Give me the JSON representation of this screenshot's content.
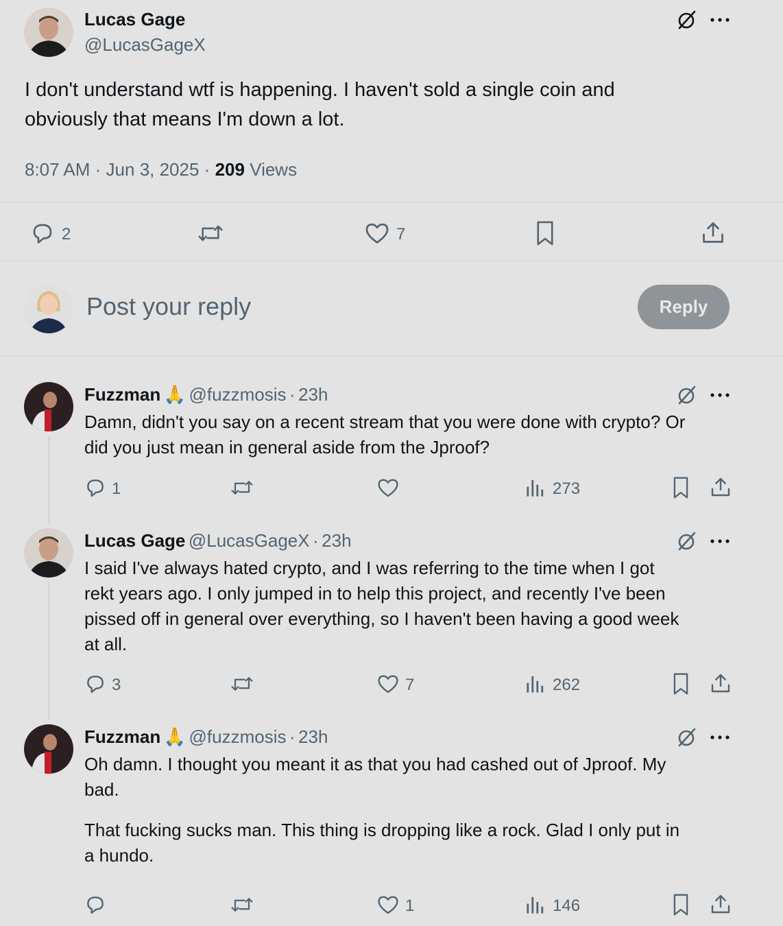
{
  "main_post": {
    "author_name": "Lucas Gage",
    "author_handle": "@LucasGageX",
    "text_line1": "I don't understand wtf is happening. I haven't sold a single coin and",
    "text_line2": "obviously that means I'm down a lot.",
    "time": "8:07 AM",
    "date": "Jun 3, 2025",
    "views_count": "209",
    "views_label": "Views",
    "replies": "2",
    "likes": "7"
  },
  "composer": {
    "placeholder": "Post your reply",
    "reply_button": "Reply"
  },
  "replies": [
    {
      "author_name": "Fuzzman",
      "emoji": "🙏",
      "author_handle": "@fuzzmosis",
      "time": "23h",
      "lines": [
        "Damn, didn't you say on a recent stream that you were done with crypto? Or",
        "did you just mean in general aside from the Jproof?"
      ],
      "replies": "1",
      "likes": "",
      "views": "273"
    },
    {
      "author_name": "Lucas Gage",
      "author_handle": "@LucasGageX",
      "time": "23h",
      "lines": [
        "I said I've always hated crypto, and I was referring to the time when I got",
        "rekt years ago. I only jumped in to help this project, and recently I've been",
        "pissed off in general over everything, so I haven't been having a good week",
        "at all."
      ],
      "replies": "3",
      "likes": "7",
      "views": "262"
    },
    {
      "author_name": "Fuzzman",
      "emoji": "🙏",
      "author_handle": "@fuzzmosis",
      "time": "23h",
      "lines": [
        "Oh damn. I thought you meant it as that you had cashed out of Jproof. My",
        "bad.",
        "",
        "That fucking sucks man. This thing is dropping like a rock. Glad I only put in",
        "a hundo."
      ],
      "replies": "",
      "likes": "1",
      "views": "146"
    }
  ],
  "separator_dot": "·",
  "colors": {
    "background": "#e3e3e3",
    "text_primary": "#0f1419",
    "text_secondary": "#536471",
    "reply_button_bg": "#8f9499"
  }
}
